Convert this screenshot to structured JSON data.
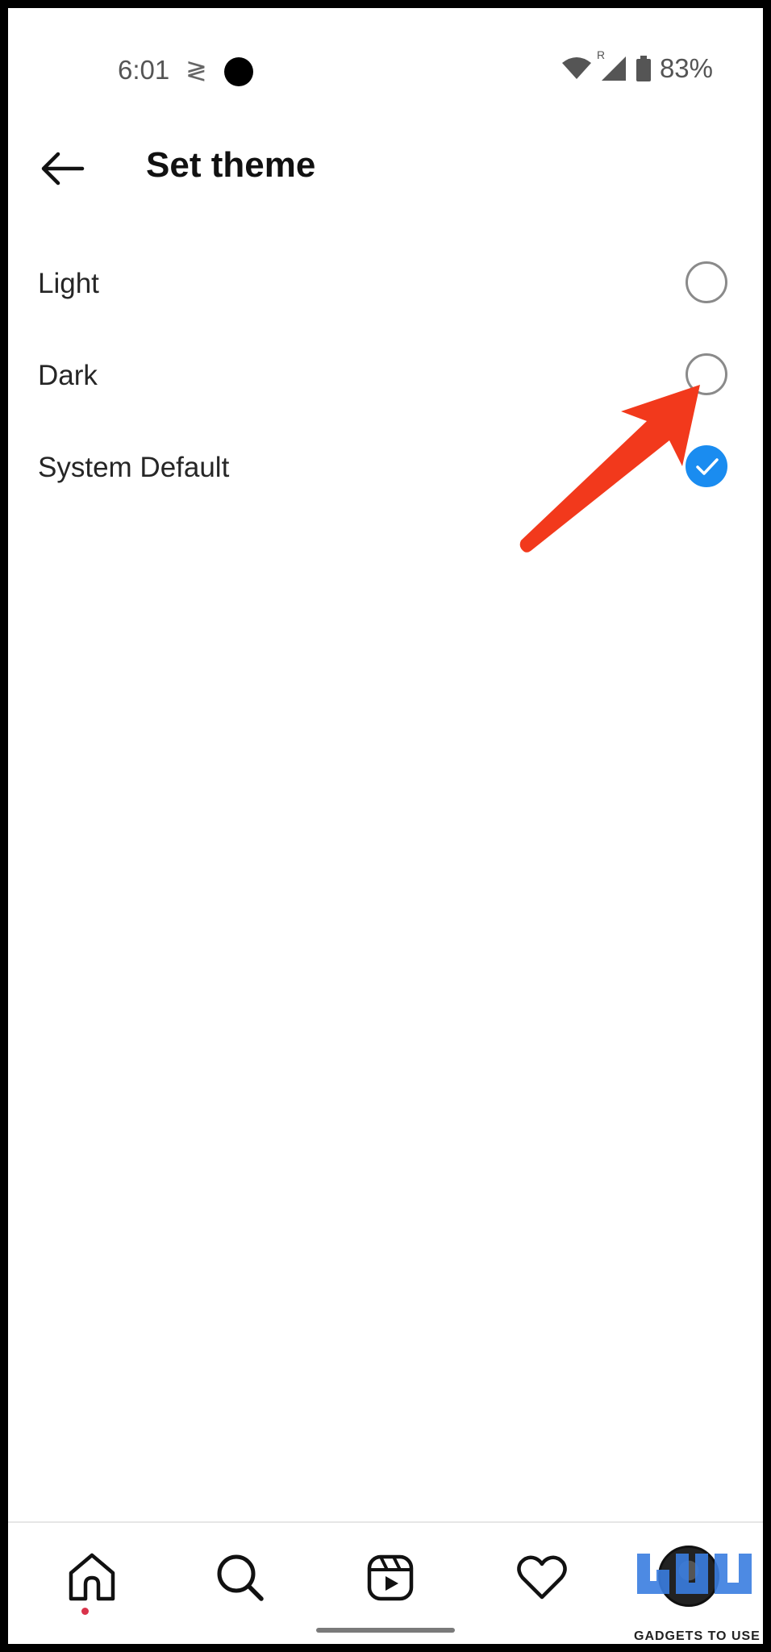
{
  "status_bar": {
    "time": "6:01",
    "data_glyph": "≷",
    "roaming_badge": "R",
    "battery": "83%"
  },
  "header": {
    "title": "Set theme"
  },
  "options": [
    {
      "label": "Light",
      "selected": false
    },
    {
      "label": "Dark",
      "selected": false
    },
    {
      "label": "System Default",
      "selected": true
    }
  ],
  "bottom_nav": {
    "items": [
      "home-icon",
      "search-icon",
      "reels-icon",
      "heart-icon",
      "profile-avatar"
    ]
  },
  "watermark": {
    "text": "GADGETS TO USE"
  },
  "colors": {
    "accent": "#1a8cf0",
    "annotation_arrow": "#f2391c",
    "notification_dot": "#d9334b"
  }
}
